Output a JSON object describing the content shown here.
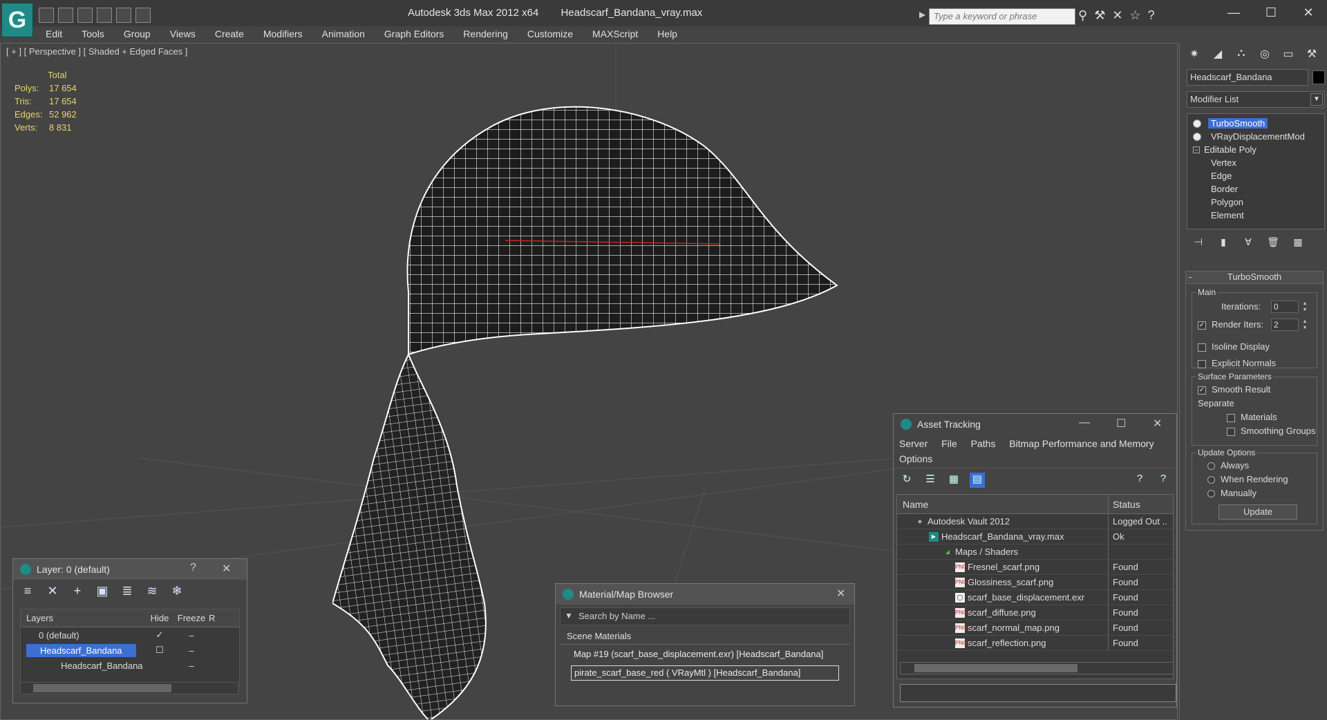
{
  "app": {
    "title": "Autodesk 3ds Max  2012 x64",
    "file": "Headscarf_Bandana_vray.max",
    "search_placeholder": "Type a keyword or phrase"
  },
  "menu": [
    "Edit",
    "Tools",
    "Group",
    "Views",
    "Create",
    "Modifiers",
    "Animation",
    "Graph Editors",
    "Rendering",
    "Customize",
    "MAXScript",
    "Help"
  ],
  "viewport": {
    "label": "[ + ] [ Perspective ] [ Shaded + Edged Faces ]",
    "stats_header": "Total",
    "stats": [
      {
        "k": "Polys:",
        "v": "17 654"
      },
      {
        "k": "Tris:",
        "v": "17 654"
      },
      {
        "k": "Edges:",
        "v": "52 962"
      },
      {
        "k": "Verts:",
        "v": "8 831"
      }
    ]
  },
  "layer_panel": {
    "title": "Layer: 0 (default)",
    "help": "?",
    "cols": {
      "layers": "Layers",
      "hide": "Hide",
      "freeze": "Freeze",
      "r": "R"
    },
    "rows": [
      {
        "name": "0 (default)"
      },
      {
        "name": "Headscarf_Bandana"
      },
      {
        "name": "Headscarf_Bandana"
      }
    ]
  },
  "material_browser": {
    "title": "Material/Map Browser",
    "search": "Search by Name ...",
    "section": "Scene Materials",
    "items": [
      "Map #19 (scarf_base_displacement.exr) [Headscarf_Bandana]",
      "pirate_scarf_base_red ( VRayMtl ) [Headscarf_Bandana]"
    ]
  },
  "asset_tracking": {
    "title": "Asset Tracking",
    "menu": [
      "Server",
      "File",
      "Paths",
      "Bitmap Performance and Memory",
      "Options"
    ],
    "cols": {
      "name": "Name",
      "status": "Status"
    },
    "rows": [
      {
        "name": "Autodesk Vault 2012",
        "status": "Logged Out ..",
        "icon": "vault-icon"
      },
      {
        "name": "Headscarf_Bandana_vray.max",
        "status": "Ok",
        "icon": "max-file-icon"
      },
      {
        "name": "Maps / Shaders",
        "status": "",
        "icon": "maps-icon"
      },
      {
        "name": "Fresnel_scarf.png",
        "status": "Found",
        "icon": "png-icon"
      },
      {
        "name": "Glossiness_scarf.png",
        "status": "Found",
        "icon": "png-icon"
      },
      {
        "name": "scarf_base_displacement.exr",
        "status": "Found",
        "icon": "exr-icon"
      },
      {
        "name": "scarf_diffuse.png",
        "status": "Found",
        "icon": "png-icon"
      },
      {
        "name": "scarf_normal_map.png",
        "status": "Found",
        "icon": "png-icon"
      },
      {
        "name": "scarf_reflection.png",
        "status": "Found",
        "icon": "png-icon"
      }
    ]
  },
  "command_panel": {
    "object_name": "Headscarf_Bandana",
    "modifier_list": "Modifier List",
    "stack": [
      {
        "label": "TurboSmooth"
      },
      {
        "label": "VRayDisplacementMod"
      },
      {
        "label": "Editable Poly"
      },
      {
        "label": "Vertex"
      },
      {
        "label": "Edge"
      },
      {
        "label": "Border"
      },
      {
        "label": "Polygon"
      },
      {
        "label": "Element"
      }
    ],
    "rollout": {
      "title": "TurboSmooth",
      "main": "Main",
      "iterations_label": "Iterations:",
      "iterations": "0",
      "render_iters_label": "Render Iters:",
      "render_iters": "2",
      "isoline": "Isoline Display",
      "explicit": "Explicit Normals",
      "surface": "Surface Parameters",
      "smooth_result": "Smooth Result",
      "separate": "Separate",
      "materials": "Materials",
      "smoothing_groups": "Smoothing Groups",
      "update_options": "Update Options",
      "always": "Always",
      "when_rendering": "When Rendering",
      "manually": "Manually",
      "update": "Update"
    }
  },
  "colors": {
    "selection": "#3c6fd1",
    "stats_text": "#e8d56b",
    "accent_teal": "#1f8a86"
  }
}
